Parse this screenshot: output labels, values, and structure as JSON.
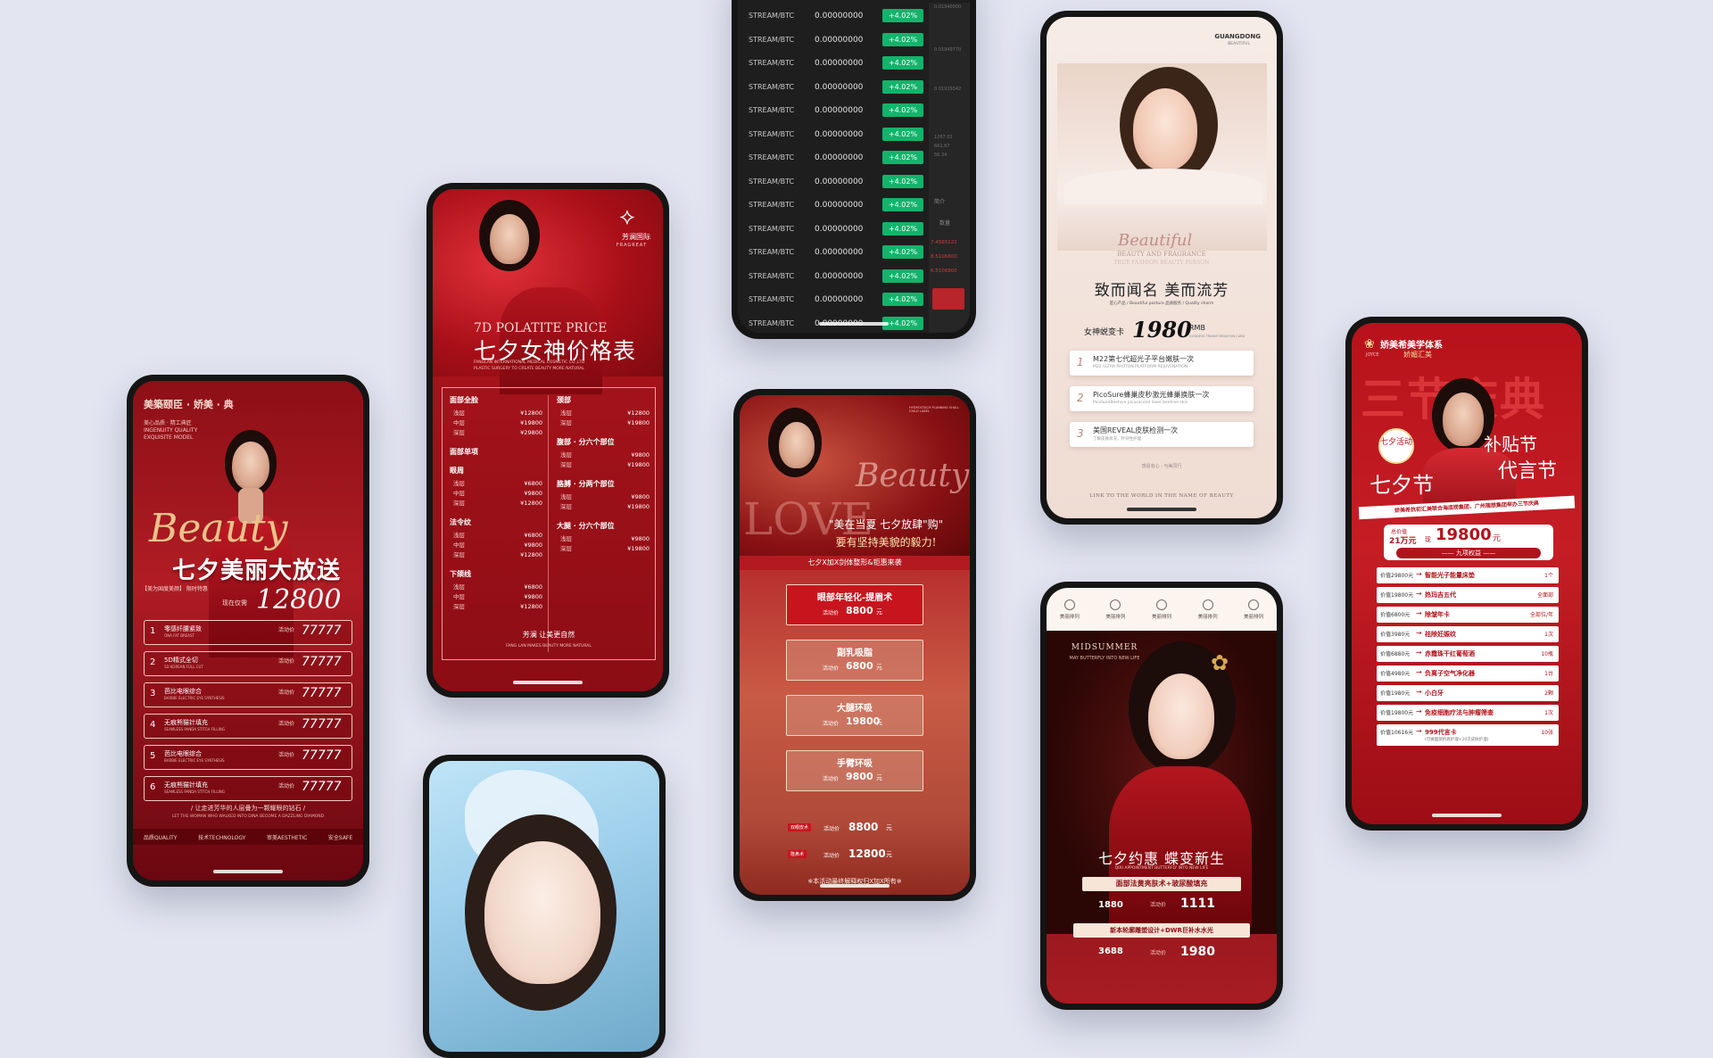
{
  "phone1": {
    "brand": "美築颐臣 · 娇美 · 典",
    "sub_lines": [
      "美心品质 · 精工典匠",
      "INGENUITY QUALITY",
      "EXQUISITE MODEL"
    ],
    "script_word": "Beauty",
    "title": "七夕美丽大放送",
    "price_prefix": "【美为国度美颜】 限时特惠",
    "price_label": "现在仅需",
    "price": "12800",
    "items": [
      {
        "num": "1",
        "name": "零感纤腰紧致",
        "en": "ONA FAT BREAST",
        "label": "活动价",
        "price": "77777"
      },
      {
        "num": "2",
        "name": "5D精式全切",
        "en": "5D KOREAN FULL CUT",
        "label": "活动价",
        "price": "77777"
      },
      {
        "num": "3",
        "name": "芭比电眼综合",
        "en": "BARBIE ELECTRIC EYE SYNTHESIS",
        "label": "活动价",
        "price": "77777"
      },
      {
        "num": "4",
        "name": "无痕熊猫针填充",
        "en": "SEAMLESS PANDA STITCH FILLING",
        "label": "活动价",
        "price": "77777"
      },
      {
        "num": "5",
        "name": "芭比电眼综合",
        "en": "BARBIE ELECTRIC EYE SYNTHESIS",
        "label": "活动价",
        "price": "77777"
      },
      {
        "num": "6",
        "name": "无痕熊猫针填充",
        "en": "SEAMLESS PANDA STITCH FILLING",
        "label": "活动价",
        "price": "77777"
      }
    ],
    "slogan": "/ 让走进芳华的人层叠为一颗耀眼的钻石 /",
    "slogan_en": "LET THE WOMAN WHO WALKED INTO DINA BECOME A DAZZLING DIAMOND",
    "footer": [
      "品质QUALITY",
      "技术TECHNOLOGY",
      "审美AESTHETIC",
      "安全SAFE"
    ]
  },
  "phone2": {
    "logo_cn": "芳澜国际",
    "logo_en": "FRAGREAT",
    "title_en": "7D POLATITE PRICE",
    "title": "七夕女神价格表",
    "sub": "FANGLAN INTERNATIONAL MEDICAL COSMETIC CO.,LTD",
    "sub2": "PLASTIC SURGERY TO CREATE BEAUTY MORE NATURAL",
    "left": [
      {
        "h": "面部全脸",
        "rows": [
          [
            "浅层",
            "¥12800"
          ],
          [
            "中层",
            "¥19800"
          ],
          [
            "深层",
            "¥29800"
          ]
        ]
      },
      {
        "h": "面部单项",
        "rows": []
      },
      {
        "h": "眼周",
        "rows": [
          [
            "浅层",
            "¥6800"
          ],
          [
            "中层",
            "¥9800"
          ],
          [
            "深层",
            "¥12800"
          ]
        ]
      },
      {
        "h": "法令纹",
        "rows": [
          [
            "浅层",
            "¥6800"
          ],
          [
            "中层",
            "¥9800"
          ],
          [
            "深层",
            "¥12800"
          ]
        ]
      },
      {
        "h": "下颌线",
        "rows": [
          [
            "浅层",
            "¥6800"
          ],
          [
            "中层",
            "¥9800"
          ],
          [
            "深层",
            "¥12800"
          ]
        ]
      }
    ],
    "right": [
      {
        "h": "颈部",
        "rows": [
          [
            "浅层",
            "¥12800"
          ],
          [
            "深层",
            "¥19800"
          ]
        ]
      },
      {
        "h": "腹部 · 分六个部位",
        "rows": [
          [
            "浅层",
            "¥9800"
          ],
          [
            "深层",
            "¥19800"
          ]
        ]
      },
      {
        "h": "胳膊 · 分两个部位",
        "rows": [
          [
            "浅层",
            "¥9800"
          ],
          [
            "深层",
            "¥19800"
          ]
        ]
      },
      {
        "h": "大腿 · 分六个部位",
        "rows": [
          [
            "浅层",
            "¥9800"
          ],
          [
            "深层",
            "¥19800"
          ]
        ]
      }
    ],
    "footer": "芳澜 让美更自然",
    "footer_en": "FANG LAN MAKES BEAUTY MORE NATURAL"
  },
  "phone3": {
    "pair": "STREAM/BTC",
    "value": "0.00000000",
    "change": "+4.02%",
    "row_count_label": "14",
    "side_values": [
      "0.01940000",
      "0.01949770",
      "0.01929342",
      "1267.01",
      "661.67",
      "56.34",
      "简介",
      "数量",
      "7.4565122",
      "8.5106800",
      "6.5106800"
    ]
  },
  "phone4": {
    "brand": "GUANGDONG",
    "brand_sub": "BEAUTIFUL",
    "script": "Beautiful",
    "en1": "BEAUTY AND FRAGRANCE",
    "en2": "TRUE FASHION BEAUTY PERSON",
    "title": "致而闻名  美而流芳",
    "tags": "匠心产品 / Beautiful posture   品质服务 / Quality charm",
    "card_label": "女神蜕变卡",
    "card_price": "1980",
    "card_unit": "RMB",
    "card_en": "GODDESS TRANSFORMATION CARD",
    "items": [
      {
        "num": "1",
        "cn": "M22第七代超光子平台嫩肤一次",
        "en": "M22 ULTRA PHOTON PLATFORM REJUVENATION"
      },
      {
        "num": "2",
        "cn": "PicoSure蜂巢皮秒激光蜂巢换肤一次",
        "en": "PicoSureBeehive picosecond laser beehive skin"
      },
      {
        "num": "3",
        "cn": "美国REVEAL皮肤检测一次",
        "en": "了解皮肤状况，针对性护理"
      }
    ],
    "thanks": "感恩有心 · 与美同行",
    "footer": "LINK TO THE WORLD IN THE NAME OF BEAUTY"
  },
  "phone5": {
    "script": "Beauty",
    "love": "LOVE",
    "headline1": "\"美在当夏 七夕放肆\"购\"",
    "headline2": "要有坚持美貌的毅力!",
    "banner": "七夕X加X剑体整形&钜惠来袭",
    "cards": [
      {
        "title": "眼部年轻化-提眉术",
        "label": "活动价",
        "price": "8800",
        "unit": "元",
        "highlight": true
      },
      {
        "title": "副乳吸脂",
        "label": "活动价",
        "price": "6800",
        "unit": "元",
        "highlight": false
      },
      {
        "title": "大腿环吸",
        "label": "活动价",
        "price": "19800",
        "unit": "元",
        "highlight": false
      },
      {
        "title": "手臂环吸",
        "label": "活动价",
        "price": "9800",
        "unit": "元",
        "highlight": false
      }
    ],
    "tiny_rows": [
      {
        "tag": "双眼皮术",
        "label": "活动价",
        "price": "8800",
        "unit": "元"
      },
      {
        "tag": "隆鼻术",
        "label": "活动价",
        "price": "12800",
        "unit": "元"
      }
    ],
    "footer": "※本活动最终解释权归X加X所有※",
    "top_tag": "HYDROGTACH PLANNING SHALL CHILD LABEL"
  },
  "phone6": {
    "nav": [
      "美丽排列",
      "美丽排列",
      "美丽排列",
      "美丽排列",
      "美丽排列"
    ],
    "en_title": "MIDSUMMER",
    "en_sub": "MAY BUTTERFLY INTO NEW LIFE",
    "title": "七夕约惠 蝶变新生",
    "sub_en": "QIXI APPOINTMENT BUTTERFLY INTO NEW LIFE",
    "banner1": "面部法黄亮肤术+玻尿酸填充",
    "p1a": "1880",
    "p1b": "1111",
    "banner2": "新本轮廓雕塑设计+DWR巨补水水光",
    "p2a": "3688",
    "p2b": "1980",
    "price_label": "活动价"
  },
  "phone7": {
    "brand": "娇美希美学体系",
    "brand2": "娇媚汇美",
    "brand_en": "JOYCE",
    "big_title": "三节庆典",
    "badge": "七夕活动",
    "t1": "七夕节",
    "t2": "补贴节",
    "t3": "代言节",
    "strip": "娇美希抗初汇美联合海底捞集团，广州理想集团举办三节庆典",
    "value_label": "总价值",
    "value_amount": "21万元",
    "value_mid": "现",
    "price": "19800",
    "price_unit": "元",
    "equity": "—— 九项权益 ——",
    "rows": [
      {
        "price": "价值29800元",
        "name": "智能光子能量床垫",
        "qty": "1个"
      },
      {
        "price": "价值19800元",
        "name": "热玛吉五代",
        "qty": "全面部"
      },
      {
        "price": "价值6800元",
        "name": "除皱年卡",
        "qty": "全部位/年"
      },
      {
        "price": "价值3980元",
        "name": "祛除妊娠纹",
        "qty": "1次"
      },
      {
        "price": "价值6880元",
        "name": "赤霞珠干红葡萄酒",
        "qty": "10瓶"
      },
      {
        "price": "价值4980元",
        "name": "负离子空气净化器",
        "qty": "1台"
      },
      {
        "price": "价值1980元",
        "name": "小白牙",
        "qty": "2颗"
      },
      {
        "price": "价值19800元",
        "name": "免疫细胞疗法与肿瘤筛查",
        "qty": "1次"
      },
      {
        "price": "价值10616元",
        "name": "999代言卡",
        "qty": "10张"
      }
    ],
    "row_note": "(可做面部抗衰护理+20次皮肤护理)"
  }
}
